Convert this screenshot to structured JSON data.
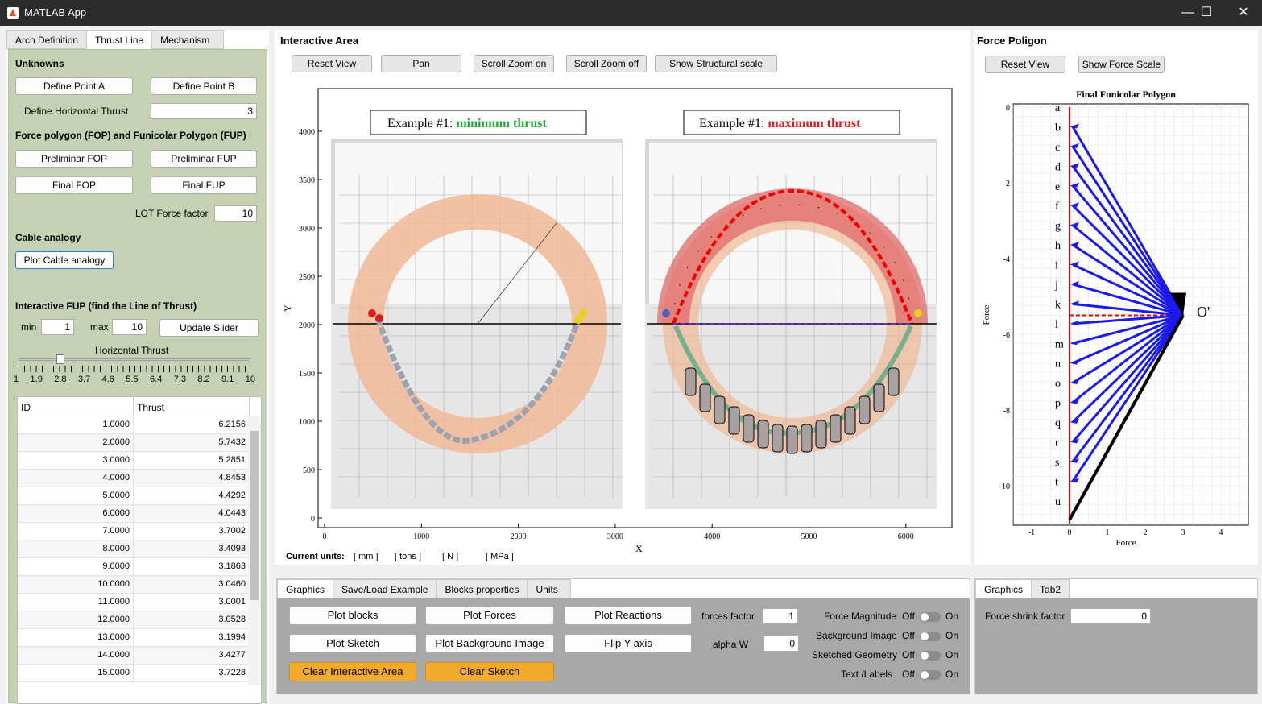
{
  "window": {
    "title": "MATLAB App",
    "minimize": "—",
    "maximize": "☐",
    "close": "✕"
  },
  "left_tabs": [
    "Arch Definition",
    "Thrust Line",
    "Mechanism"
  ],
  "unknowns": {
    "title": "Unknowns",
    "define_a": "Define Point A",
    "define_b": "Define Point B",
    "horiz_label": "Define Horizontal Thrust",
    "horiz_value": "3"
  },
  "fop": {
    "title": "Force polygon (FOP) and Funicolar Polygon (FUP)",
    "pre_fop": "Preliminar FOP",
    "pre_fup": "Preliminar FUP",
    "final_fop": "Final FOP",
    "final_fup": "Final FUP",
    "lot_label": "LOT Force factor",
    "lot_value": "10"
  },
  "cable": {
    "title": "Cable analogy",
    "button": "Plot Cable analogy"
  },
  "ifup": {
    "title": "Interactive FUP (find the Line of Thrust)",
    "min_label": "min",
    "min_value": "1",
    "max_label": "max",
    "max_value": "10",
    "update": "Update Slider",
    "slider_label": "Horizontal Thrust",
    "slider_value": 2.5,
    "ticks": [
      "1",
      "1.9",
      "2.8",
      "3.7",
      "4.6",
      "5.5",
      "6.4",
      "7.3",
      "8.2",
      "9.1",
      "10"
    ]
  },
  "table": {
    "headers": [
      "ID",
      "Thrust"
    ],
    "rows": [
      [
        "1.0000",
        "6.2156"
      ],
      [
        "2.0000",
        "5.7432"
      ],
      [
        "3.0000",
        "5.2851"
      ],
      [
        "4.0000",
        "4.8453"
      ],
      [
        "5.0000",
        "4.4292"
      ],
      [
        "6.0000",
        "4.0443"
      ],
      [
        "7.0000",
        "3.7002"
      ],
      [
        "8.0000",
        "3.4093"
      ],
      [
        "9.0000",
        "3.1863"
      ],
      [
        "10.0000",
        "3.0460"
      ],
      [
        "11.0000",
        "3.0001"
      ],
      [
        "12.0000",
        "3.0528"
      ],
      [
        "13.0000",
        "3.1994"
      ],
      [
        "14.0000",
        "3.4277"
      ],
      [
        "15.0000",
        "3.7228"
      ]
    ]
  },
  "interactive": {
    "title": "Interactive Area",
    "buttons": [
      "Reset View",
      "Pan",
      "Scroll Zoom on",
      "Scroll Zoom off",
      "Show Structural scale"
    ],
    "xlabel": "X",
    "ylabel": "Y",
    "yticks": [
      "0",
      "500",
      "1000",
      "1500",
      "2000",
      "2500",
      "3000",
      "3500",
      "4000"
    ],
    "xticks": [
      "0",
      "1000",
      "2000",
      "3000",
      "4000",
      "5000",
      "6000"
    ],
    "ex1_prefix": "Example #1:",
    "ex1_suffix": "minimum thrust",
    "ex2_prefix": "Example #1:",
    "ex2_suffix": "maximum thrust",
    "units": {
      "label": "Current units:",
      "mm": "[ mm ]",
      "tons": "[ tons ]",
      "n": "[ N ]",
      "mpa": "[ MPa ]"
    }
  },
  "force_polygon": {
    "title": "Force Poligon",
    "buttons": [
      "Reset View",
      "Show Force Scale"
    ],
    "plot_title": "Final Funicolar Polygon",
    "xlabel": "Force",
    "ylabel": "Force",
    "yticks": [
      "0",
      "-2",
      "-4",
      "-6",
      "-8",
      "-10"
    ],
    "xticks": [
      "-1",
      "0",
      "1",
      "2",
      "3",
      "4"
    ],
    "letters": [
      "a",
      "b",
      "c",
      "d",
      "e",
      "f",
      "g",
      "h",
      "i",
      "j",
      "k",
      "l",
      "m",
      "n",
      "o",
      "p",
      "q",
      "r",
      "s",
      "t",
      "u"
    ],
    "pole": "O'"
  },
  "bottom": {
    "tabs": [
      "Graphics",
      "Save/Load Example",
      "Blocks properties",
      "Units"
    ],
    "plot_blocks": "Plot blocks",
    "plot_forces": "Plot Forces",
    "plot_reactions": "Plot Reactions",
    "plot_sketch": "Plot Sketch",
    "plot_bg": "Plot Background Image",
    "flip_y": "Flip Y axis",
    "clear_ia": "Clear Interactive Area",
    "clear_sketch": "Clear Sketch",
    "forces_factor_label": "forces factor",
    "forces_factor_value": "1",
    "alpha_label": "alpha W",
    "alpha_value": "0",
    "toggles": [
      {
        "label": "Force Magnitude",
        "off": "Off",
        "on": "On"
      },
      {
        "label": "Background Image",
        "off": "Off",
        "on": "On"
      },
      {
        "label": "Sketched Geometry",
        "off": "Off",
        "on": "On"
      },
      {
        "label": "Text /Labels",
        "off": "Off",
        "on": "On"
      }
    ]
  },
  "bottom_right": {
    "tabs": [
      "Graphics",
      "Tab2"
    ],
    "shrink_label": "Force shrink factor",
    "shrink_value": "0"
  }
}
